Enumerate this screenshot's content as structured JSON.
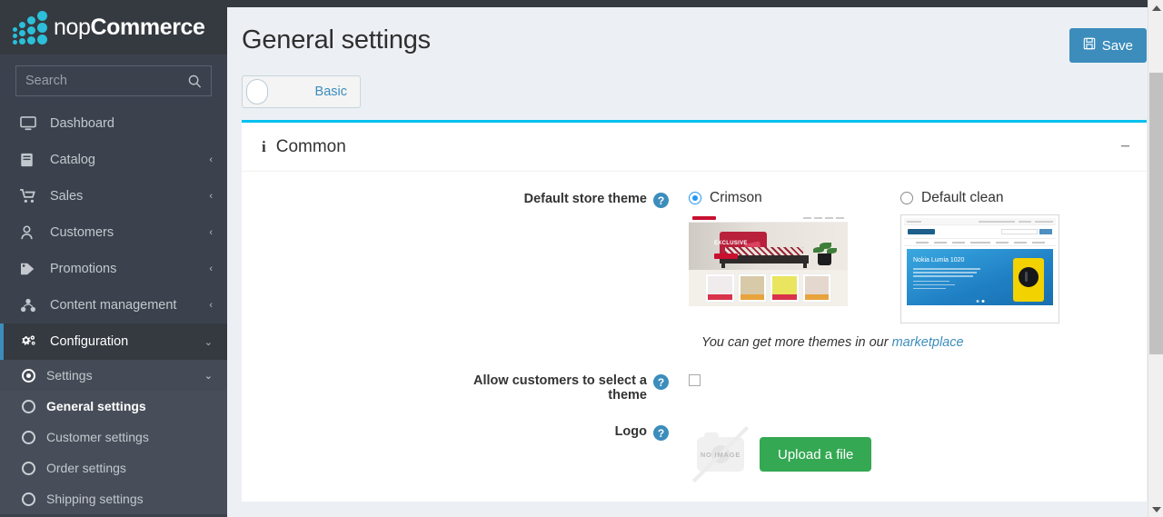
{
  "brand": {
    "light": "nop",
    "bold": "Commerce"
  },
  "search": {
    "placeholder": "Search",
    "value": ""
  },
  "sidebar": {
    "items": [
      {
        "label": "Dashboard",
        "icon": "desktop-icon",
        "caret": ""
      },
      {
        "label": "Catalog",
        "icon": "book-icon",
        "caret": "‹"
      },
      {
        "label": "Sales",
        "icon": "cart-icon",
        "caret": "‹"
      },
      {
        "label": "Customers",
        "icon": "user-icon",
        "caret": "‹"
      },
      {
        "label": "Promotions",
        "icon": "tag-icon",
        "caret": "‹"
      },
      {
        "label": "Content management",
        "icon": "sitemap-icon",
        "caret": "‹"
      },
      {
        "label": "Configuration",
        "icon": "gears-icon",
        "caret": "⌄"
      }
    ],
    "settings_group": {
      "label": "Settings",
      "caret": "⌄"
    },
    "settings_items": [
      {
        "label": "General settings",
        "current": true
      },
      {
        "label": "Customer settings",
        "current": false
      },
      {
        "label": "Order settings",
        "current": false
      },
      {
        "label": "Shipping settings",
        "current": false
      }
    ]
  },
  "header": {
    "title": "General settings",
    "save_label": "Save",
    "save_icon": "floppy-disk-icon",
    "save_color": "#3c8dbc"
  },
  "toggle": {
    "label": "Basic",
    "checked": false
  },
  "card": {
    "title": "Common",
    "info_icon": "info-icon",
    "collapse_icon": "minus-icon",
    "accent_color": "#00c0ef"
  },
  "form": {
    "theme": {
      "label": "Default store theme",
      "help": "?",
      "options": [
        {
          "name": "Crimson",
          "selected": true,
          "banner_text": "EXCLUSIVE"
        },
        {
          "name": "Default clean",
          "selected": false,
          "banner_text": "Nokia Lumia 1020"
        }
      ],
      "note_prefix": "You can get more themes in our ",
      "note_link": "marketplace"
    },
    "allow_select": {
      "label_line1": "Allow customers to select a",
      "label_line2": "theme",
      "help": "?",
      "checked": false
    },
    "logo": {
      "label": "Logo",
      "help": "?",
      "placeholder_text": "NO IMAGE",
      "upload_label": "Upload a file",
      "upload_color": "#34a853"
    }
  }
}
